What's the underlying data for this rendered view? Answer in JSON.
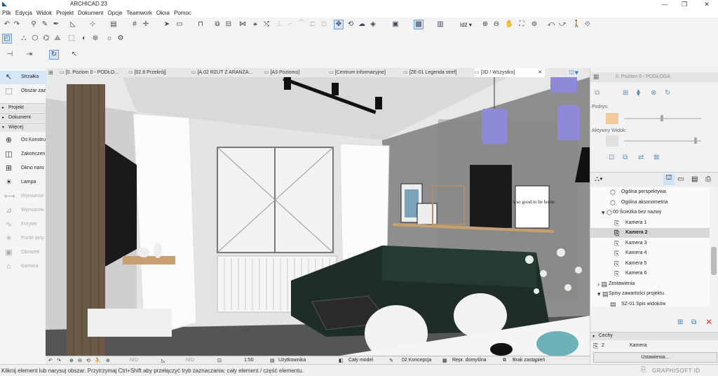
{
  "window": {
    "title": "ARCHICAD 23",
    "min": "—",
    "max": "❐",
    "close": "✕"
  },
  "menu": [
    "Plik",
    "Edycja",
    "Widok",
    "Projekt",
    "Dokument",
    "Opcje",
    "Teamwork",
    "Okna",
    "Pomoc"
  ],
  "toolbox": {
    "tools_top": [
      {
        "name": "arrow-tool",
        "label": "Strzałka",
        "icon": "↖",
        "selected": true
      },
      {
        "name": "marquee-tool",
        "label": "Obszar zaz",
        "icon": "⬚"
      }
    ],
    "sections": [
      "Projekt",
      "Dokument",
      "Więcej"
    ],
    "tools_more": [
      {
        "name": "gridline-tool",
        "label": "Oś Konstru",
        "icon": "⊕"
      },
      {
        "name": "endcap-tool",
        "label": "Zakończen",
        "icon": "◫"
      },
      {
        "name": "corner-window-tool",
        "label": "Okno naro",
        "icon": "⊞"
      },
      {
        "name": "lamp-tool",
        "label": "Lampa",
        "icon": "☀"
      },
      {
        "name": "dimension-tool",
        "label": "Wymiarow",
        "icon": "⟷",
        "disabled": true
      },
      {
        "name": "level-dimension-tool",
        "label": "Wymiarow",
        "icon": "⊿",
        "disabled": true
      },
      {
        "name": "curve-tool",
        "label": "Krzywe",
        "icon": "∿",
        "disabled": true
      },
      {
        "name": "hotspot-tool",
        "label": "Punkt akty",
        "icon": "✳",
        "disabled": true
      },
      {
        "name": "figure-tool",
        "label": "Obrazek",
        "icon": "▣",
        "disabled": true
      },
      {
        "name": "camera-tool",
        "label": "Kamera",
        "icon": "⌂",
        "disabled": true
      }
    ]
  },
  "tabs": [
    {
      "label": "[0. Poziom 0 - PODŁO...",
      "w": 96
    },
    {
      "label": "[02.8 Przekrój]",
      "w": 88
    },
    {
      "label": "[A.02 RZUT Z ARANŻA...",
      "w": 102
    },
    {
      "label": "[A3 Poziomo]",
      "w": 90
    },
    {
      "label": "[Centrum informacyjne]",
      "w": 104
    },
    {
      "label": "[ZE-01 Legenda stref]",
      "w": 100
    },
    {
      "label": "[3D / Wszystko]",
      "w": 100,
      "active": true,
      "close": "✕"
    }
  ],
  "right_panel": {
    "header": "0. Poziom 0 - PODŁOGA",
    "podrys_label": "Podrys:",
    "aktywny_label": "Aktywny Widok:",
    "tree": [
      {
        "label": "Ogólna perspektywa",
        "indent": 28,
        "icon": "⬡"
      },
      {
        "label": "Ogólna aksonometria",
        "indent": 28,
        "icon": "⬡"
      },
      {
        "label": "00 Ścieżka bez nazwy",
        "indent": 16,
        "icon": "▾ ⬡"
      },
      {
        "label": "Kamera 1",
        "indent": 34,
        "icon": "⎘"
      },
      {
        "label": "Kamera 2",
        "indent": 34,
        "icon": "⎘",
        "selected": true
      },
      {
        "label": "Kamera 3",
        "indent": 34,
        "icon": "⎘"
      },
      {
        "label": "Kamera 4",
        "indent": 34,
        "icon": "⎘"
      },
      {
        "label": "Kamera 5",
        "indent": 34,
        "icon": "⎘"
      },
      {
        "label": "Kamera 6",
        "indent": 34,
        "icon": "⎘"
      },
      {
        "label": "Zestawienia",
        "indent": 10,
        "icon": "› ▤"
      },
      {
        "label": "Spisy zawartości projektu",
        "indent": 10,
        "icon": "▾ ▤"
      },
      {
        "label": "SZ-01 Spis widoków",
        "indent": 28,
        "icon": "▤"
      }
    ],
    "cechy_label": "Cechy",
    "cechy_id": "2",
    "cechy_value": "Kamera",
    "settings_button": "Ustawienia..."
  },
  "viewbar": {
    "nd1": "N/D",
    "nd2": "N/D",
    "scale": "1:50",
    "layer": "Użytkownika",
    "model": "Cały model",
    "concept": "02 Koncepcja",
    "repr": "Repr. domyślna",
    "override": "Brak zastąpień"
  },
  "status": {
    "message": "Kliknij element lub narysuj obszar. Przytrzymaj Ctrl+Shift aby przełączyć tryb zaznaczania: cały element / część elementu.",
    "brand": "GRAPHISOFT ID"
  },
  "poster_text": "it's so good to be home"
}
